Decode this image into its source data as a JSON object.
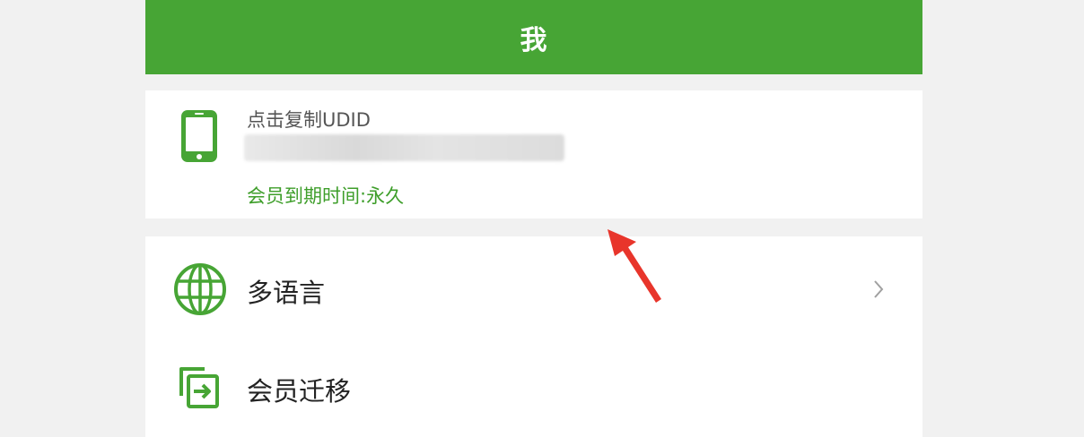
{
  "header": {
    "title": "我",
    "background_color": "#47a535"
  },
  "profile": {
    "icon": "phone-icon",
    "udid_label": "点击复制UDID",
    "udid_value": "",
    "expiry_text": "会员到期时间:永久",
    "accent_color": "#3e9e2a"
  },
  "menu": {
    "items": [
      {
        "icon": "globe-icon",
        "label": "多语言",
        "has_chevron": true
      },
      {
        "icon": "transfer-icon",
        "label": "会员迁移",
        "has_chevron": false
      }
    ]
  },
  "annotation": {
    "icon": "red-arrow-icon",
    "color": "#e8352b"
  }
}
